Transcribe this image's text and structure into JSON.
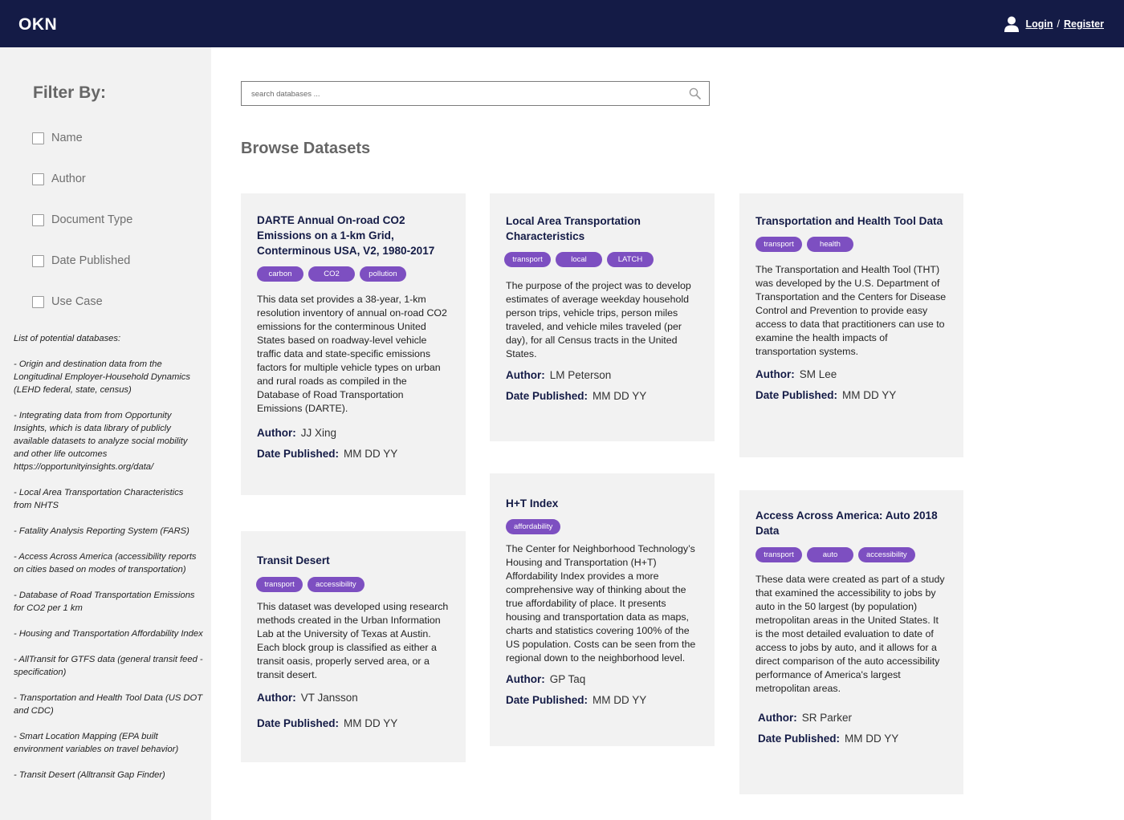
{
  "header": {
    "logo": "OKN",
    "login_label": "Login",
    "separator": "/",
    "register_label": "Register"
  },
  "sidebar": {
    "filter_title": "Filter By:",
    "filters": [
      "Name",
      "Author",
      "Document Type",
      "Date Published",
      "Use Case"
    ],
    "db_list_heading": "List of potential databases:",
    "db_list": [
      "- Origin and destination data from the Longitudinal Employer-Household Dynamics (LEHD federal, state, census)",
      "- Integrating data from from Opportunity Insights, which is data library of publicly available datasets to analyze social mobility and other life outcomes https://opportunityinsights.org/data/",
      "- Local Area Transportation Characteristics from NHTS",
      "- Fatality Analysis Reporting System (FARS)",
      "- Access Across America (accessibility reports on cities based on modes of transportation)",
      "- Database of Road Transportation Emissions for CO2 per 1 km",
      "- Housing and Transportation Affordability Index",
      "- AllTransit for GTFS data (general transit feed - specification)",
      "- Transportation and Health Tool Data (US DOT and CDC)",
      "- Smart Location Mapping (EPA built environment variables on travel behavior)",
      "- Transit Desert (Alltransit Gap Finder)"
    ]
  },
  "search": {
    "placeholder": "search databases ..."
  },
  "main": {
    "title": "Browse Datasets"
  },
  "labels": {
    "author": "Author:",
    "date": "Date Published:"
  },
  "cards": [
    {
      "title": "DARTE Annual On-road CO2 Emissions on a 1-km Grid, Conterminous USA, V2, 1980-2017",
      "tags": [
        "carbon",
        "CO2",
        "pollution"
      ],
      "description": "This data set provides a 38-year, 1-km resolution inventory of annual on-road CO2 emissions for the conterminous United States based on roadway-level vehicle traffic data and state-specific emissions factors for multiple vehicle types on urban and rural roads as compiled in the Database of Road Transportation Emissions (DARTE).",
      "author": "JJ Xing",
      "date": "MM DD YY"
    },
    {
      "title": "Local Area Transportation Characteristics",
      "tags": [
        "transport",
        "local",
        "LATCH"
      ],
      "description": "The purpose of the project was to develop estimates of average weekday household person trips, vehicle trips, person miles traveled, and vehicle miles traveled (per day), for all Census tracts in the United States.",
      "author": "LM Peterson",
      "date": "MM DD YY"
    },
    {
      "title": "Transportation and Health Tool Data",
      "tags": [
        "transport",
        "health"
      ],
      "description": "The Transportation and Health Tool (THT) was developed by the U.S. Department of Transportation and the Centers for Disease Control and Prevention to provide easy access to data that practitioners can use to examine the health impacts of transportation systems.",
      "author": "SM Lee",
      "date": "MM DD YY"
    },
    {
      "title": "Transit Desert",
      "tags": [
        "transport",
        "accessibility"
      ],
      "description": "This dataset was developed using research methods created in the Urban Information Lab at the University of Texas at Austin. Each block group is classified as either a transit oasis, properly served area, or a transit desert.",
      "author": "VT Jansson",
      "date": "MM DD YY"
    },
    {
      "title": "H+T Index",
      "tags": [
        "affordability"
      ],
      "description": "The Center for Neighborhood Technology’s Housing and Transportation (H+T) Affordability Index provides a more comprehensive way of thinking about the true affordability of place. It presents housing and transportation data as maps, charts and statistics covering 100% of the US population. Costs can be seen from the regional down to the neighborhood level.",
      "author": "GP Taq",
      "date": "MM DD YY"
    },
    {
      "title": "Access Across America: Auto 2018 Data",
      "tags": [
        "transport",
        "auto",
        "accessibility"
      ],
      "description": "These data were created as part of a study that examined the accessibility to jobs by auto in the 50 largest (by population) metropolitan areas in the United States. It is the most detailed evaluation to date of access to jobs by auto, and it allows for a direct comparison of the auto accessibility performance of America's largest metropolitan areas.",
      "author": "SR Parker",
      "date": "MM DD YY"
    }
  ]
}
